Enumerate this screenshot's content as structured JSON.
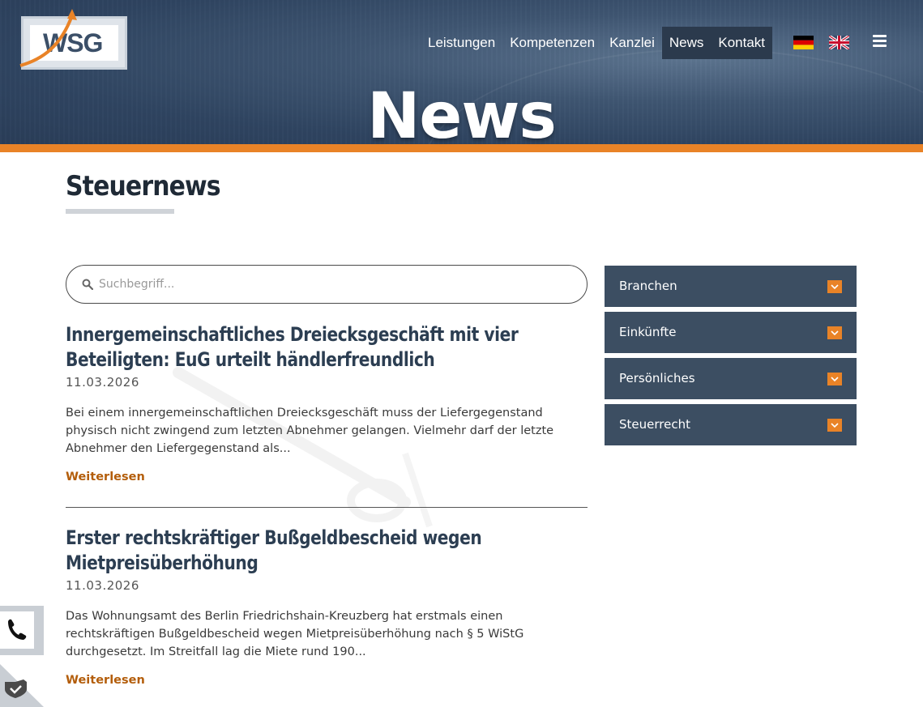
{
  "brand": {
    "logo_text": "WSG"
  },
  "nav": {
    "items": [
      {
        "label": "Leistungen",
        "active": false
      },
      {
        "label": "Kompetenzen",
        "active": false
      },
      {
        "label": "Kanzlei",
        "active": false
      },
      {
        "label": "News",
        "active": true
      },
      {
        "label": "Kontakt",
        "active": true
      }
    ]
  },
  "hero": {
    "title": "News"
  },
  "section": {
    "title": "Steuernews"
  },
  "search": {
    "placeholder": "Suchbegriff..."
  },
  "articles": [
    {
      "title": "Innergemeinschaftliches Dreiecksgeschäft mit vier Beteiligten: EuG urteilt händlerfreundlich",
      "date": "11.03.2026",
      "excerpt": "Bei einem innergemeinschaftlichen Dreiecksgeschäft muss der Liefergegenstand physisch nicht zwingend zum letzten Abnehmer gelangen. Vielmehr darf der letzte Abnehmer den Liefergegenstand als...",
      "read_more": "Weiterlesen"
    },
    {
      "title": "Erster rechtskräftiger Bußgeldbescheid wegen Mietpreisüberhöhung",
      "date": "11.03.2026",
      "excerpt": "Das Wohnungsamt des Berlin Friedrichshain-Kreuzberg hat erstmals einen rechtskräftigen Bußgeldbescheid wegen Mietpreisüberhöhung nach § 5 WiStG durchgesetzt. Im Streitfall lag die Miete rund 190...",
      "read_more": "Weiterlesen"
    }
  ],
  "sidebar": {
    "categories": [
      {
        "label": "Branchen"
      },
      {
        "label": "Einkünfte"
      },
      {
        "label": "Persönliches"
      },
      {
        "label": "Steuerrecht"
      }
    ]
  },
  "colors": {
    "header_bg": "#2f4461",
    "accent": "#e98327",
    "accordion_bg": "#3c4e62",
    "link": "#b35d0a",
    "nav_active": "#2b3a4d"
  },
  "icons": [
    "search-icon",
    "chevron-down-icon",
    "phone-icon",
    "shield-check-icon",
    "menu-icon",
    "flag-de-icon",
    "flag-en-icon"
  ]
}
